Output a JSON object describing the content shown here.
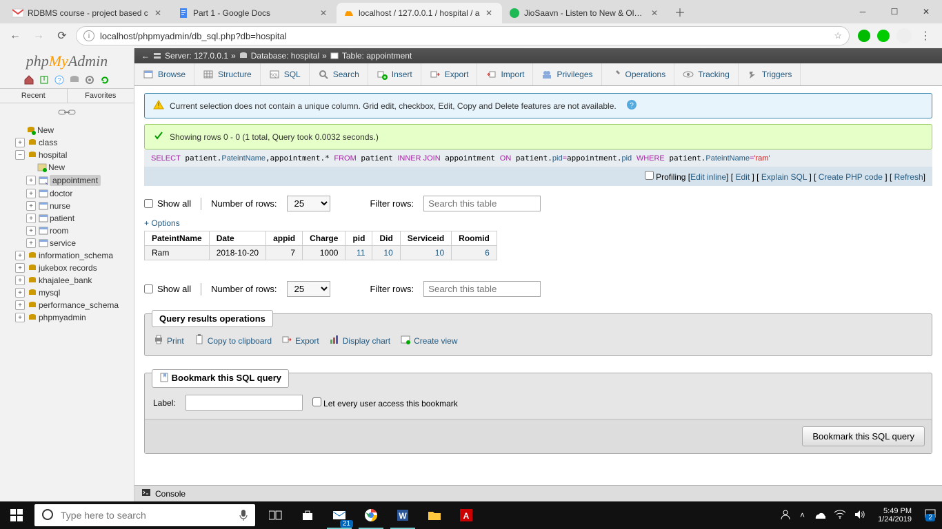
{
  "chrome": {
    "tabs": [
      {
        "title": "RDBMS course - project based c",
        "icon": "gmail"
      },
      {
        "title": "Part 1 - Google Docs",
        "icon": "docs"
      },
      {
        "title": "localhost / 127.0.0.1 / hospital / a",
        "icon": "pma"
      },
      {
        "title": "JioSaavn - Listen to New & Old H",
        "icon": "jiosaavn"
      }
    ],
    "url": "localhost/phpmyadmin/db_sql.php?db=hospital"
  },
  "sidebar": {
    "recent": "Recent",
    "favorites": "Favorites",
    "nodes": {
      "new": "New",
      "class": "class",
      "hospital": "hospital",
      "hospital_children": {
        "new": "New",
        "appointment": "appointment",
        "doctor": "doctor",
        "nurse": "nurse",
        "patient": "patient",
        "room": "room",
        "service": "service"
      },
      "information_schema": "information_schema",
      "jukebox": "jukebox records",
      "khajalee": "khajalee_bank",
      "mysql": "mysql",
      "perf": "performance_schema",
      "phpmyadmin": "phpmyadmin"
    }
  },
  "breadcrumb": {
    "server": "Server: 127.0.0.1",
    "database": "Database: hospital",
    "table": "Table: appointment"
  },
  "topnav": {
    "browse": "Browse",
    "structure": "Structure",
    "sql": "SQL",
    "search": "Search",
    "insert": "Insert",
    "export": "Export",
    "import": "Import",
    "privileges": "Privileges",
    "operations": "Operations",
    "tracking": "Tracking",
    "triggers": "Triggers"
  },
  "notice_text": "Current selection does not contain a unique column. Grid edit, checkbox, Edit, Copy and Delete features are not available.",
  "success_text": "Showing rows 0 - 0 (1 total, Query took 0.0032 seconds.)",
  "sql_query_plain": "SELECT patient.PateintName,appointment.* FROM patient INNER JOIN appointment ON patient.pid=appointment.pid WHERE patient.PateintName='ram'",
  "profiling": "Profiling",
  "actions": {
    "edit_inline": "Edit inline",
    "edit": "Edit",
    "explain": "Explain SQL",
    "php": "Create PHP code",
    "refresh": "Refresh"
  },
  "controls": {
    "show_all": "Show all",
    "num_rows": "Number of rows:",
    "rows_value": "25",
    "filter_label": "Filter rows:",
    "filter_placeholder": "Search this table"
  },
  "options_label": "+ Options",
  "table": {
    "headers": [
      "PateintName",
      "Date",
      "appid",
      "Charge",
      "pid",
      "Did",
      "Serviceid",
      "Roomid"
    ],
    "rows": [
      {
        "PateintName": "Ram",
        "Date": "2018-10-20",
        "appid": "7",
        "Charge": "1000",
        "pid": "11",
        "Did": "10",
        "Serviceid": "10",
        "Roomid": "6"
      }
    ]
  },
  "ops_panel": {
    "title": "Query results operations",
    "print": "Print",
    "copy": "Copy to clipboard",
    "export": "Export",
    "chart": "Display chart",
    "view": "Create view"
  },
  "bookmark": {
    "title": "Bookmark this SQL query",
    "label": "Label:",
    "share": "Let every user access this bookmark",
    "button": "Bookmark this SQL query"
  },
  "console": "Console",
  "taskbar": {
    "search_placeholder": "Type here to search",
    "time": "5:49 PM",
    "date": "1/24/2019",
    "notif_count": "2",
    "mail_badge": "21"
  }
}
